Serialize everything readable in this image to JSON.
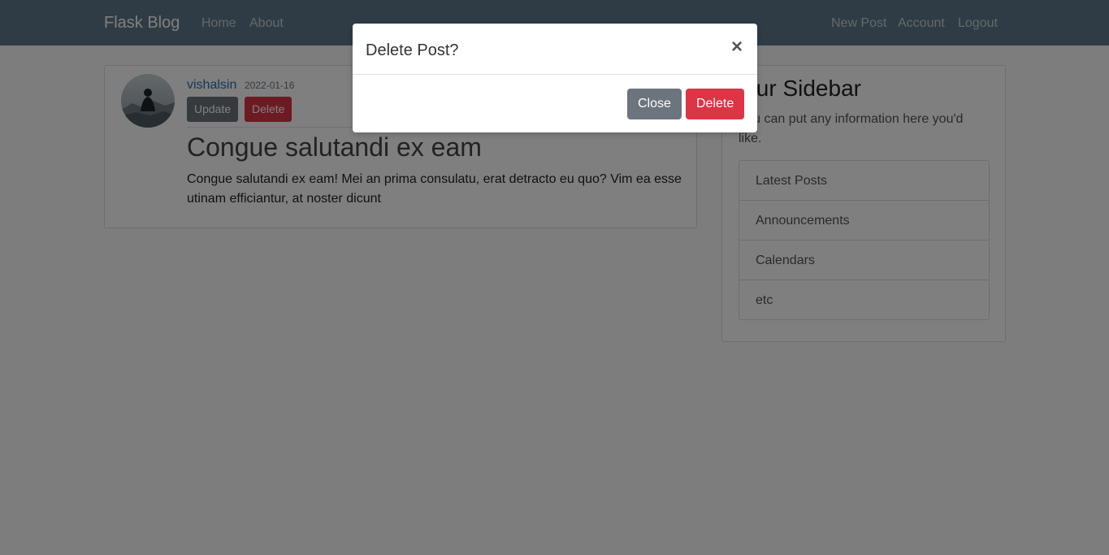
{
  "navbar": {
    "brand": "Flask Blog",
    "left_links": [
      "Home",
      "About"
    ],
    "right_links": [
      "New Post",
      "Account",
      "Logout"
    ]
  },
  "post": {
    "author": "vishalsin",
    "date": "2022-01-16",
    "update_label": "Update",
    "delete_label": "Delete",
    "title": "Congue salutandi ex eam",
    "content": "Congue salutandi ex eam! Mei an prima consulatu, erat detracto eu quo? Vim ea esse utinam efficiantur, at noster dicunt"
  },
  "sidebar": {
    "title": "Our Sidebar",
    "text": "You can put any information here you'd like.",
    "items": [
      "Latest Posts",
      "Announcements",
      "Calendars",
      "etc"
    ]
  },
  "modal": {
    "title": "Delete Post?",
    "close_x": "×",
    "close_label": "Close",
    "delete_label": "Delete"
  },
  "colors": {
    "navbar": "#5f788a",
    "danger": "#dc3545",
    "secondary": "#6c757d",
    "link": "#2b6cb0"
  }
}
